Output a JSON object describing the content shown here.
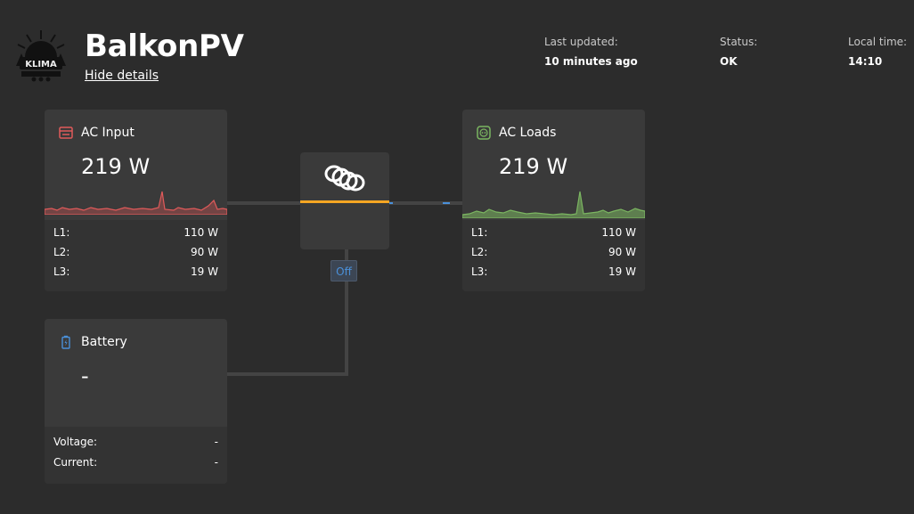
{
  "header": {
    "site_name": "BalkonPV",
    "hide_details": "Hide details",
    "last_updated_label": "Last updated:",
    "last_updated_value": "10 minutes ago",
    "status_label": "Status:",
    "status_value": "OK",
    "local_time_label": "Local time:",
    "local_time_value": "14:10",
    "logo_text": "KLIMA"
  },
  "ac_input": {
    "title": "AC Input",
    "value": "219 W",
    "icon": "ac-input-icon",
    "color": "#e05a5a",
    "rows": [
      {
        "label": "L1:",
        "value": "110 W"
      },
      {
        "label": "L2:",
        "value": "90 W"
      },
      {
        "label": "L3:",
        "value": "19 W"
      }
    ]
  },
  "ac_loads": {
    "title": "AC Loads",
    "value": "219 W",
    "icon": "socket-icon",
    "color": "#7bb661",
    "rows": [
      {
        "label": "L1:",
        "value": "110 W"
      },
      {
        "label": "L2:",
        "value": "90 W"
      },
      {
        "label": "L3:",
        "value": "19 W"
      }
    ]
  },
  "battery": {
    "title": "Battery",
    "value": "-",
    "icon": "battery-icon",
    "color": "#4a90d9",
    "rows": [
      {
        "label": "Voltage:",
        "value": "-"
      },
      {
        "label": "Current:",
        "value": "-"
      }
    ]
  },
  "inverter": {
    "mode": "Off",
    "icon": "victron-logo-icon",
    "accent": "#f5a623"
  }
}
